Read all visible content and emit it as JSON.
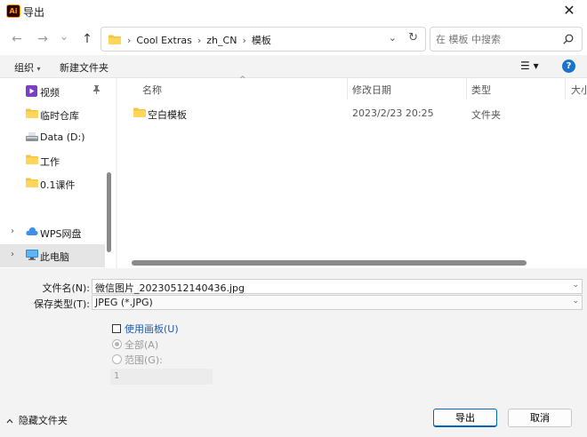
{
  "window": {
    "app_icon_text": "Ai",
    "title": "导出",
    "close_glyph": "✕"
  },
  "nav": {
    "back_glyph": "←",
    "forward_glyph": "→",
    "recent_glyph": "⌄",
    "up_glyph": "↑",
    "breadcrumbs": [
      "Cool Extras",
      "zh_CN",
      "模板"
    ],
    "separator": "›",
    "dropdown_glyph": "⌄",
    "refresh_glyph": "↻",
    "search_placeholder": "在 模板 中搜索"
  },
  "commandbar": {
    "organize": "组织",
    "organize_arrow": "▾",
    "new_folder": "新建文件夹",
    "view_glyph": "☰ ▾",
    "help_glyph": "?"
  },
  "navpane": {
    "items": [
      {
        "label": "视频",
        "icon": "video-icon",
        "pinned": true
      },
      {
        "label": "临时仓库",
        "icon": "folder-icon"
      },
      {
        "label": "Data (D:)",
        "icon": "drive-icon"
      },
      {
        "label": "工作",
        "icon": "folder-icon"
      },
      {
        "label": "0.1课件",
        "icon": "folder-icon"
      },
      {
        "label": "WPS网盘",
        "icon": "cloud-icon",
        "expandable": true
      },
      {
        "label": "此电脑",
        "icon": "computer-icon",
        "expandable": true,
        "selected": true
      }
    ],
    "pin_glyph": "📌",
    "chevron_glyph": "›"
  },
  "filelist": {
    "columns": [
      "名称",
      "修改日期",
      "类型",
      "大小"
    ],
    "sort_glyph": "^",
    "rows": [
      {
        "name": "空白模板",
        "modified": "2023/2/23 20:25",
        "type": "文件夹"
      }
    ]
  },
  "form": {
    "filename_label": "文件名(N):",
    "filename_value": "微信图片_20230512140436.jpg",
    "filetype_label": "保存类型(T):",
    "filetype_value": "JPEG (*.JPG)",
    "dropdown_glyph": "⌄",
    "use_artboards": "使用画板(U)",
    "all_label": "全部(A)",
    "range_label": "范围(G):",
    "range_value": "1"
  },
  "footer": {
    "hide_folders": "隐藏文件夹",
    "hide_glyph": "∧",
    "export_button": "导出",
    "cancel_button": "取消"
  },
  "colors": {
    "accent": "#0067c0",
    "folder": "#f4c542",
    "selected_row": "#e5e5e5"
  }
}
